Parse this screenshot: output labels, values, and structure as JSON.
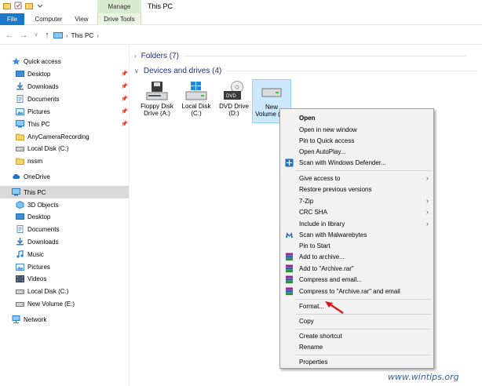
{
  "titlebar": {
    "title": "This PC",
    "manage_label": "Manage"
  },
  "ribbon": {
    "tabs": [
      "File",
      "Computer",
      "View",
      "Drive Tools"
    ]
  },
  "address": {
    "path": "This PC"
  },
  "sidebar": {
    "items": [
      {
        "label": "Quick access",
        "icon": "star-icon",
        "pinned": false
      },
      {
        "label": "Desktop",
        "icon": "desktop-folder-icon",
        "pinned": true
      },
      {
        "label": "Downloads",
        "icon": "download-arrow-icon",
        "pinned": true
      },
      {
        "label": "Documents",
        "icon": "documents-icon",
        "pinned": true
      },
      {
        "label": "Pictures",
        "icon": "pictures-icon",
        "pinned": true
      },
      {
        "label": "This PC",
        "icon": "computer-icon",
        "pinned": true
      },
      {
        "label": "AnyCameraRecording",
        "icon": "folder-icon",
        "pinned": false
      },
      {
        "label": "Local Disk (C:)",
        "icon": "drive-icon",
        "pinned": false
      },
      {
        "label": "nssm",
        "icon": "folder-icon",
        "pinned": false
      },
      {
        "label": "OneDrive",
        "icon": "cloud-icon",
        "pinned": false
      },
      {
        "label": "This PC",
        "icon": "computer-icon",
        "pinned": false,
        "selected": true
      },
      {
        "label": "3D Objects",
        "icon": "objects-3d-icon",
        "pinned": false
      },
      {
        "label": "Desktop",
        "icon": "desktop-folder-icon",
        "pinned": false
      },
      {
        "label": "Documents",
        "icon": "documents-icon",
        "pinned": false
      },
      {
        "label": "Downloads",
        "icon": "download-arrow-icon",
        "pinned": false
      },
      {
        "label": "Music",
        "icon": "music-icon",
        "pinned": false
      },
      {
        "label": "Pictures",
        "icon": "pictures-icon",
        "pinned": false
      },
      {
        "label": "Videos",
        "icon": "videos-icon",
        "pinned": false
      },
      {
        "label": "Local Disk (C:)",
        "icon": "drive-icon",
        "pinned": false
      },
      {
        "label": "New Volume (E:)",
        "icon": "drive-icon",
        "pinned": false
      },
      {
        "label": "Network",
        "icon": "network-icon",
        "pinned": false
      }
    ]
  },
  "content": {
    "folders_header": "Folders (7)",
    "devices_header": "Devices and drives (4)",
    "drives": [
      {
        "line1": "Floppy Disk",
        "line2": "Drive (A:)",
        "icon": "floppy-drive-icon"
      },
      {
        "line1": "Local Disk",
        "line2": "(C:)",
        "icon": "windows-drive-icon"
      },
      {
        "line1": "DVD Drive",
        "line2": "(D:)",
        "icon": "dvd-drive-icon"
      },
      {
        "line1": "New",
        "line2": "Volume (E:)",
        "icon": "drive-icon",
        "selected": true
      }
    ]
  },
  "context_menu": {
    "items": [
      {
        "label": "Open",
        "bold": true
      },
      {
        "label": "Open in new window"
      },
      {
        "label": "Pin to Quick access"
      },
      {
        "label": "Open AutoPlay..."
      },
      {
        "label": "Scan with Windows Defender...",
        "icon": "defender-shield-icon"
      },
      {
        "label": "Give access to",
        "submenu": true
      },
      {
        "label": "Restore previous versions"
      },
      {
        "label": "7-Zip",
        "submenu": true
      },
      {
        "label": "CRC SHA",
        "submenu": true
      },
      {
        "label": "Include in library",
        "submenu": true
      },
      {
        "label": "Scan with Malwarebytes",
        "icon": "malwarebytes-icon"
      },
      {
        "label": "Pin to Start"
      },
      {
        "label": "Add to archive...",
        "icon": "winrar-icon"
      },
      {
        "label": "Add to \"Archive.rar\"",
        "icon": "winrar-icon"
      },
      {
        "label": "Compress and email...",
        "icon": "winrar-icon"
      },
      {
        "label": "Compress to \"Archive.rar\" and email",
        "icon": "winrar-icon"
      },
      {
        "label": "Format..."
      },
      {
        "label": "Copy"
      },
      {
        "label": "Create shortcut"
      },
      {
        "label": "Rename"
      },
      {
        "label": "Properties"
      }
    ]
  },
  "watermark": "www.wintips.org",
  "colors": {
    "accent": "#1979ca",
    "selection": "#cce8ff",
    "annotation_arrow": "#d7191c"
  }
}
